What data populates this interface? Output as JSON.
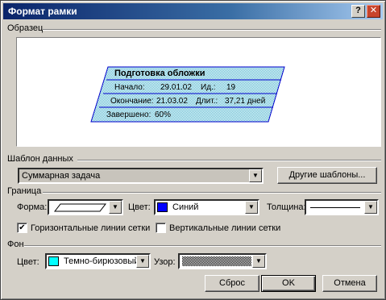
{
  "window": {
    "title": "Формат рамки",
    "help_glyph": "?",
    "close_glyph": "✕"
  },
  "sections": {
    "sample": "Образец",
    "data_template": "Шаблон данных",
    "border": "Граница",
    "background": "Фон"
  },
  "preview": {
    "name": "Подготовка обложки",
    "row1": {
      "start_label": "Начало:",
      "start_value": "29.01.02",
      "id_label": "Ид.:",
      "id_value": "19"
    },
    "row2": {
      "end_label": "Окончание:",
      "end_value": "21.03.02",
      "dur_label": "Длит.:",
      "dur_value": "37,21 дней"
    },
    "row3": {
      "done_label": "Завершено:",
      "done_value": "60%"
    },
    "fill_color": "#99d6e6",
    "border_color": "#0000cc"
  },
  "data_template": {
    "selected": "Суммарная задача",
    "other_templates_button": "Другие шаблоны..."
  },
  "border": {
    "shape_label": "Форма:",
    "color_label": "Цвет:",
    "color_value": "Синий",
    "color_swatch": "#0000ff",
    "thickness_label": "Толщина:",
    "horizontal_gridlines_label": "Горизонтальные линии сетки",
    "horizontal_gridlines_checked": true,
    "vertical_gridlines_label": "Вертикальные линии сетки",
    "vertical_gridlines_checked": false,
    "check_glyph": "✔"
  },
  "background": {
    "color_label": "Цвет:",
    "color_value": "Темно-бирюзовый",
    "color_swatch": "#00ffff",
    "pattern_label": "Узор:"
  },
  "buttons": {
    "reset": "Сброс",
    "ok": "OK",
    "cancel": "Отмена"
  },
  "arrow_glyph": "▼"
}
